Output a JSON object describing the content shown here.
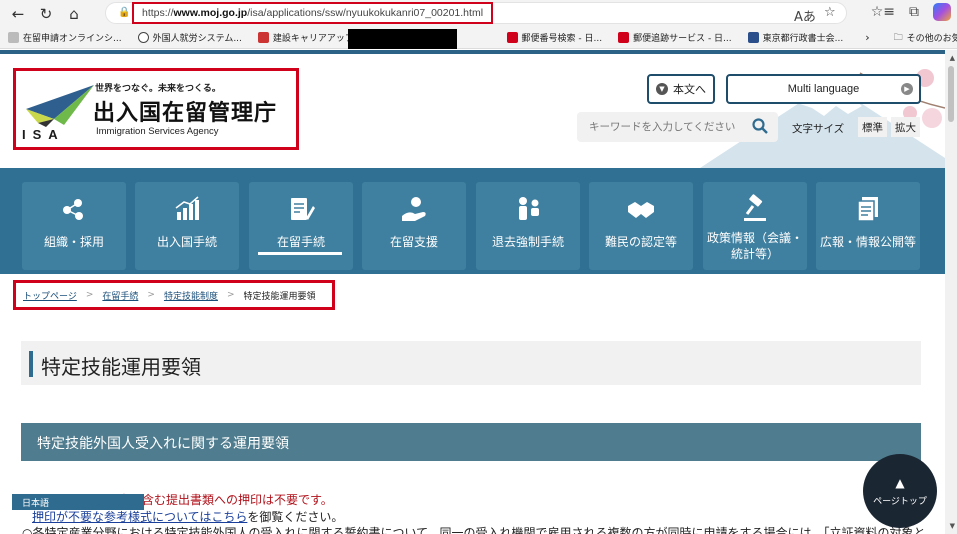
{
  "browser": {
    "url_prefix": "https://",
    "url_domain": "www.moj.go.jp",
    "url_path": "/isa/applications/ssw/nyuukokukanri07_00201.html",
    "bookmarks": [
      "在留申請オンラインシ...",
      "外国人就労システム...",
      "建設キャリアアップシス...",
      "郵便番号検索 - 日...",
      "郵便追跡サービス - 日...",
      "東京都行政書士会...",
      "その他のお気に入り"
    ]
  },
  "header": {
    "logo_tagline": "世界をつなぐ。未来をつくる。",
    "logo_name": "出入国在留管理庁",
    "logo_en": "Immigration Services Agency",
    "logo_isa": "ISA",
    "btn_honbun": "本文へ",
    "btn_multi": "Multi language",
    "search_placeholder": "キーワードを入力してください",
    "fontsize_label": "文字サイズ",
    "fs_standard": "標準",
    "fs_large": "拡大"
  },
  "nav": {
    "items": [
      {
        "label": "組織・採用"
      },
      {
        "label": "出入国手続"
      },
      {
        "label": "在留手続"
      },
      {
        "label": "在留支援"
      },
      {
        "label": "退去強制手続"
      },
      {
        "label": "難民の認定等"
      },
      {
        "label_line1": "政策情報（会議・",
        "label_line2": "統計等）"
      },
      {
        "label": "広報・情報公開等"
      }
    ]
  },
  "breadcrumb": {
    "items": [
      "トップページ",
      "在留手続",
      "特定技能制度"
    ],
    "current": "特定技能運用要領",
    "separator": ">"
  },
  "main": {
    "page_title": "特定技能運用要領",
    "section_title": "特定技能外国人受入れに関する運用要領",
    "note1": "書を含む提出書類への押印は不要です。",
    "note2_link": "押印が不要な参考様式についてはこちら",
    "note2_suffix": "を御覧ください。",
    "note3": "○各特定産業分野における特定技能外国人の受入れに関する誓約書について、同一の受入れ機関で雇用される複数の方が同時に申請をする場合には、「立証資料の対象と"
  },
  "language_badge": "日本語",
  "pagetop": {
    "arrow": "▲",
    "label": "ページトップ"
  }
}
